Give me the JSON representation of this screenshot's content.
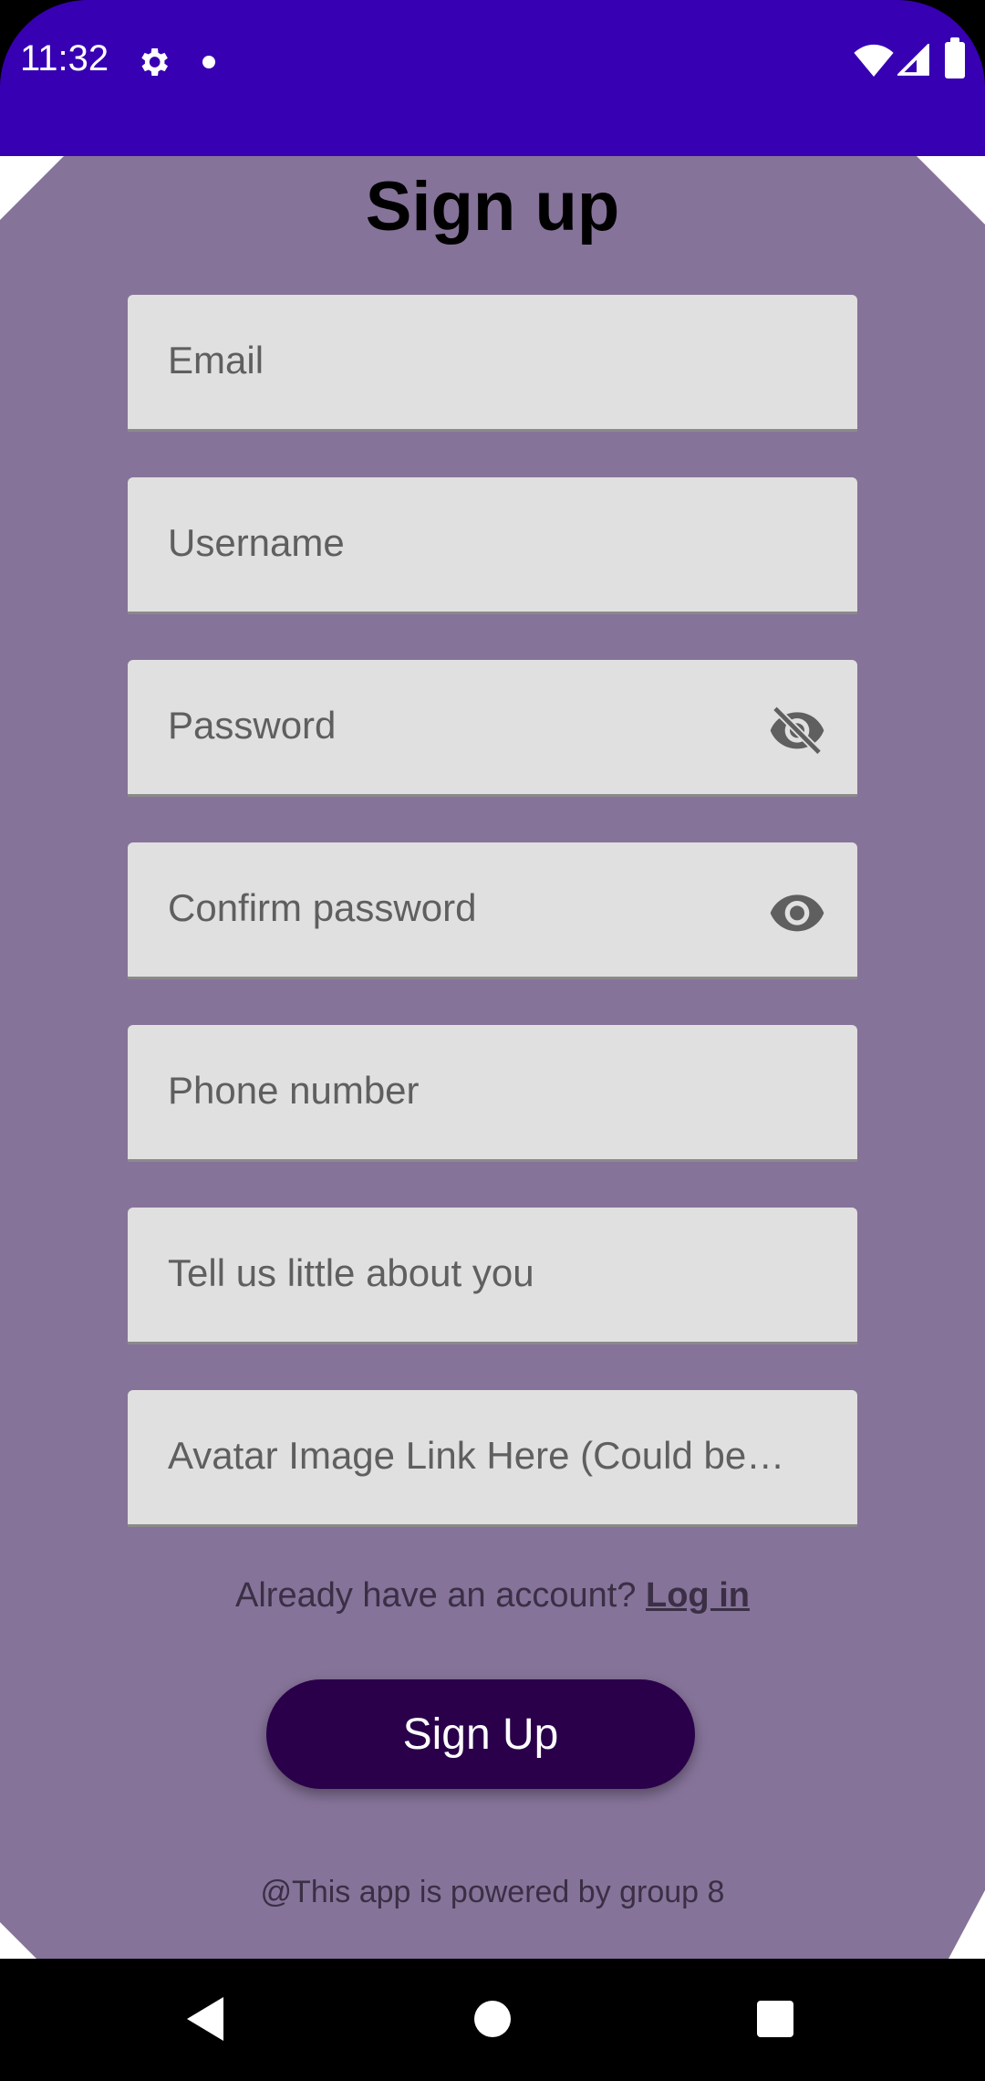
{
  "status_bar": {
    "time": "11:32",
    "icons": [
      "gear-icon",
      "notification-dot-icon",
      "wifi-icon",
      "cell-signal-icon",
      "battery-icon"
    ],
    "background": "#3700b3"
  },
  "page": {
    "title": "Sign up",
    "panel_color": "#867399"
  },
  "form": {
    "fields": [
      {
        "label": "Email"
      },
      {
        "label": "Username"
      },
      {
        "label": "Password",
        "icon": "visibility-off-icon"
      },
      {
        "label": "Confirm password",
        "icon": "visibility-icon"
      },
      {
        "label": "Phone number"
      },
      {
        "label": "Tell us little about you"
      },
      {
        "label": "Avatar Image Link Here (Could be…"
      }
    ]
  },
  "login_prompt": {
    "text": "Already have an account? ",
    "link_label": "Log in"
  },
  "signup_button": {
    "label": "Sign Up",
    "color": "#2a004a"
  },
  "footer": {
    "text": "@This app is powered by group 8"
  },
  "nav_bar": {
    "icons": [
      "back-icon",
      "home-icon",
      "recents-icon"
    ]
  }
}
